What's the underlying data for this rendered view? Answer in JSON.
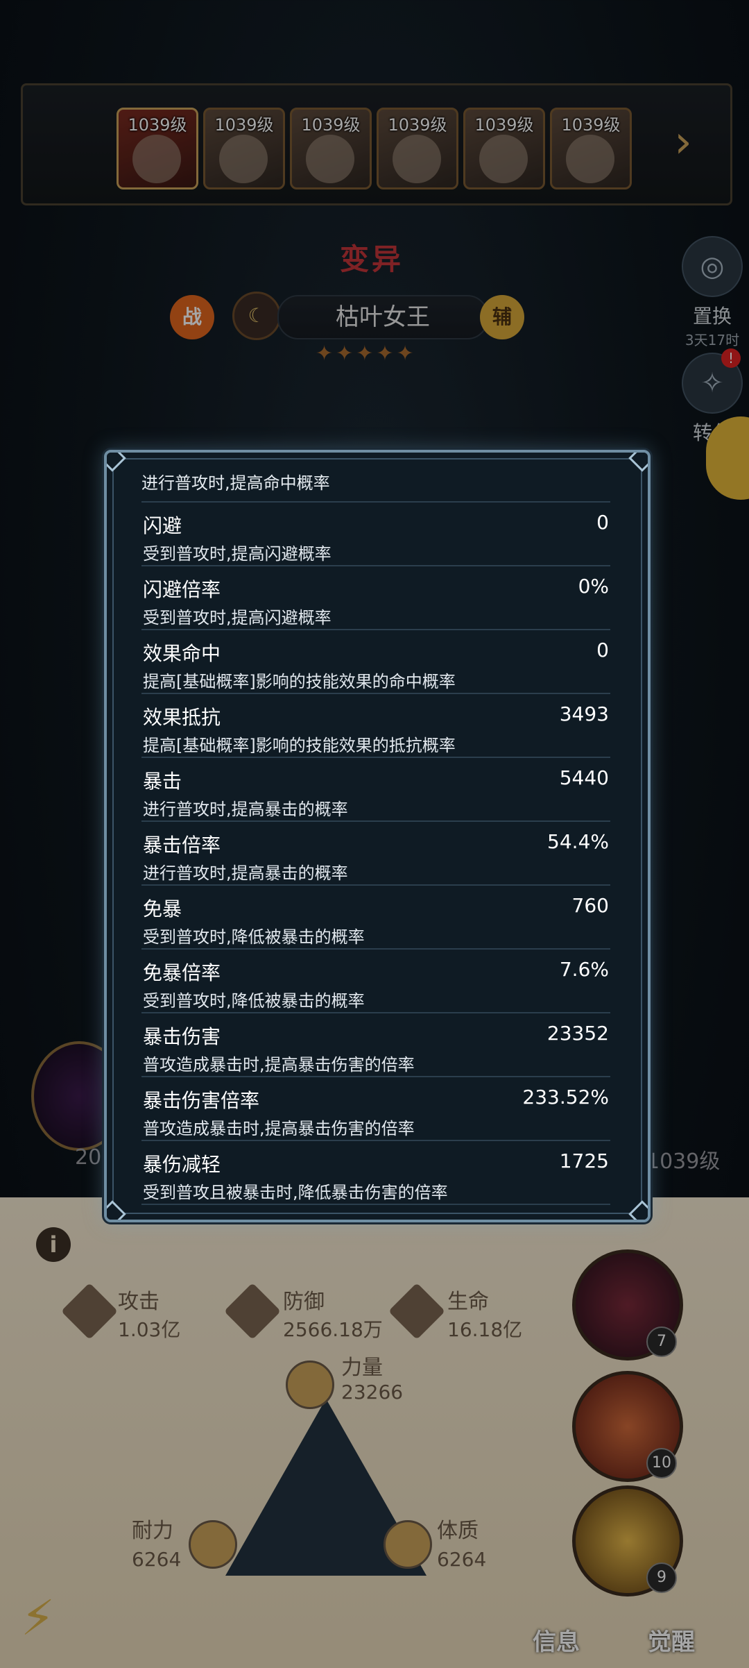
{
  "hero_strip": {
    "levels": [
      "1039级",
      "1039级",
      "1039级",
      "1039级",
      "1039级",
      "1039级"
    ]
  },
  "hero": {
    "mutation_label": "变异",
    "name": "枯叶女王",
    "badge_left": "战",
    "badge_right": "辅",
    "stars": "✦✦✦✦✦"
  },
  "side_buttons": {
    "replace_label": "置换",
    "replace_timer": "3天17时",
    "convert_label": "转化",
    "convert_badge": "!"
  },
  "background_stats": {
    "left_number": "20",
    "right_level": "1039级",
    "attack_label": "攻击",
    "attack_value": "1.03亿",
    "defense_label": "防御",
    "defense_value": "2566.18万",
    "life_label": "生命",
    "life_value": "16.18亿",
    "strength_label": "力量",
    "strength_value": "23266",
    "endurance_label": "耐力",
    "endurance_value": "6264",
    "constitution_label": "体质",
    "constitution_value": "6264"
  },
  "skills": {
    "levels": [
      "7",
      "10",
      "9"
    ]
  },
  "bottom_tabs": {
    "info": "信息",
    "awaken": "觉醒"
  },
  "modal": {
    "top_desc": "进行普攻时,提高命中概率",
    "rows": [
      {
        "title": "闪避",
        "desc": "受到普攻时,提高闪避概率",
        "value": "0"
      },
      {
        "title": "闪避倍率",
        "desc": "受到普攻时,提高闪避概率",
        "value": "0%"
      },
      {
        "title": "效果命中",
        "desc": "提高[基础概率]影响的技能效果的命中概率",
        "value": "0"
      },
      {
        "title": "效果抵抗",
        "desc": "提高[基础概率]影响的技能效果的抵抗概率",
        "value": "3493"
      },
      {
        "title": "暴击",
        "desc": "进行普攻时,提高暴击的概率",
        "value": "5440"
      },
      {
        "title": "暴击倍率",
        "desc": "进行普攻时,提高暴击的概率",
        "value": "54.4%"
      },
      {
        "title": "免暴",
        "desc": "受到普攻时,降低被暴击的概率",
        "value": "760"
      },
      {
        "title": "免暴倍率",
        "desc": "受到普攻时,降低被暴击的概率",
        "value": "7.6%"
      },
      {
        "title": "暴击伤害",
        "desc": "普攻造成暴击时,提高暴击伤害的倍率",
        "value": "23352"
      },
      {
        "title": "暴击伤害倍率",
        "desc": "普攻造成暴击时,提高暴击伤害的倍率",
        "value": "233.52%"
      },
      {
        "title": "暴伤减轻",
        "desc": "受到普攻且被暴击时,降低暴击伤害的倍率",
        "value": "1725"
      }
    ]
  }
}
